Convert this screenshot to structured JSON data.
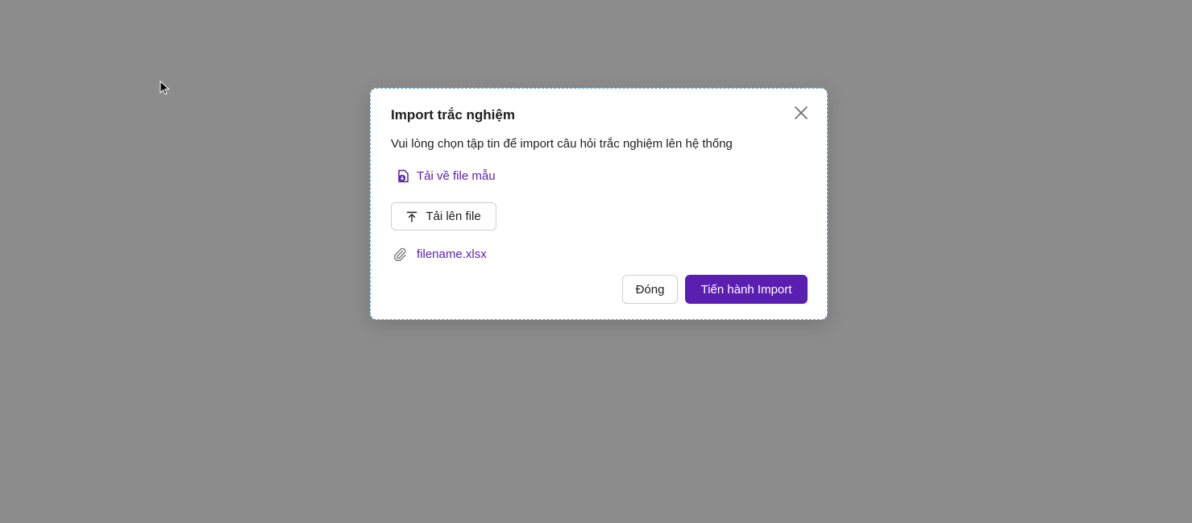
{
  "colors": {
    "accent": "#5a1fb0",
    "backdrop": "#8c8c8c"
  },
  "dialog": {
    "title": "Import trắc nghiệm",
    "description": "Vui lòng chọn tập tin để import câu hỏi trắc nghiệm lên hệ thống",
    "download_template": {
      "label": "Tải về file mẫu",
      "icon": "file-download-icon"
    },
    "upload": {
      "label": "Tải lên file",
      "icon": "upload-arrow-icon"
    },
    "attachment": {
      "file_name": "filename.xlsx",
      "icon": "paperclip-icon"
    },
    "close_icon": "close-icon",
    "buttons": {
      "cancel_label": "Đóng",
      "import_label": "Tiến hành Import"
    }
  }
}
